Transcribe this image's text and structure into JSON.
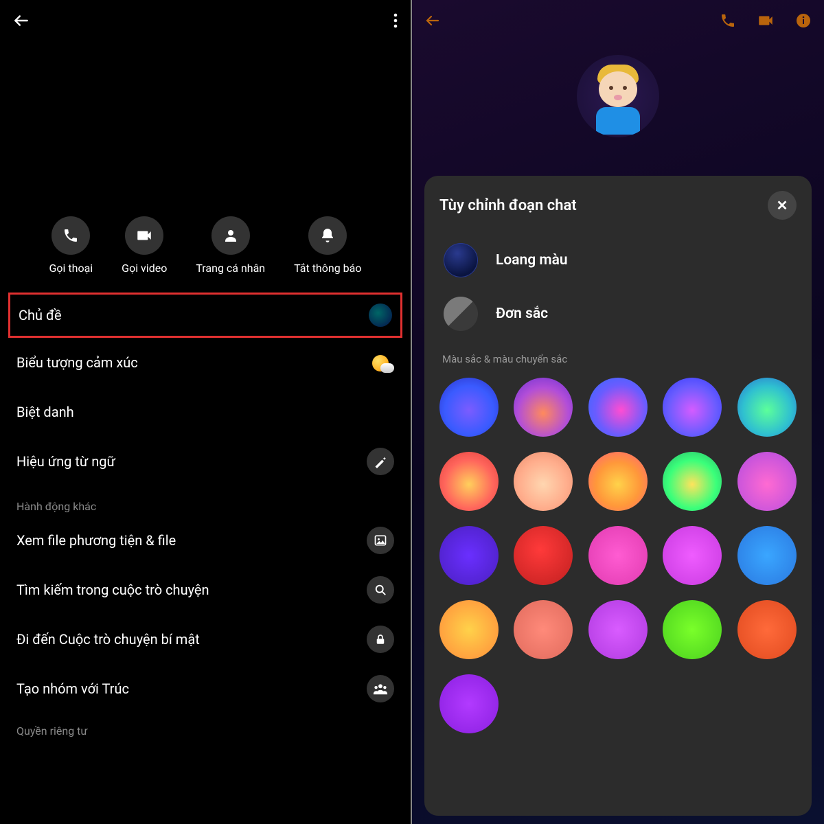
{
  "left": {
    "actions": {
      "call": "Gọi thoại",
      "video": "Gọi video",
      "profile": "Trang cá nhân",
      "mute": "Tắt thông báo"
    },
    "menu": {
      "theme": "Chủ đề",
      "emoji": "Biểu tượng cảm xúc",
      "nickname": "Biệt danh",
      "word_effects": "Hiệu ứng từ ngữ"
    },
    "sections": {
      "other": "Hành động khác",
      "privacy": "Quyền riêng tư"
    },
    "other": {
      "media": "Xem file phương tiện & file",
      "search": "Tìm kiếm trong cuộc trò chuyện",
      "secret": "Đi đến Cuộc trò chuyện bí mật",
      "group": "Tạo nhóm với Trúc"
    }
  },
  "right": {
    "sheet_title": "Tùy chỉnh đoạn chat",
    "option_gradient": "Loang màu",
    "option_solid": "Đơn sắc",
    "grid_label": "Màu sắc & màu chuyển sắc",
    "colors": [
      "radial-gradient(circle at 50% 55%, #7b5cff, #3a5bff 55%, #2a2fbf)",
      "radial-gradient(circle at 50% 60%, #ff8a5c, #b24ed8 55%, #6a2fd0)",
      "radial-gradient(circle at 55% 55%, #ff4dd2, #6a5cff 55%, #2f6aff)",
      "radial-gradient(circle at 50% 55%, #d45cff, #6a5cff 55%, #2f3aff)",
      "radial-gradient(circle at 50% 55%, #5cff9a, #2fc0d0 55%, #2a6ad0)",
      "radial-gradient(circle at 50% 55%, #ffcf5c, #ff665c 55%, #e03a3a)",
      "radial-gradient(circle at 50% 55%, #ffd6b0, #ffad8c 55%, #e88a6a)",
      "radial-gradient(circle at 50% 55%, #ffd24a, #ff983a 50%, #ff5c7a)",
      "radial-gradient(circle at 50% 55%, #ffe35c, #3aff7a 55%, #2ab06a)",
      "radial-gradient(circle at 50% 55%, #ff6ad2, #b04ae0)",
      "radial-gradient(circle at 50% 50%, #6a2fff, #4a1fc0)",
      "radial-gradient(circle at 45% 40%, #ff3a3a, #c01f1f)",
      "radial-gradient(circle at 50% 50%, #ff5cd2, #e03ab0)",
      "radial-gradient(circle at 50% 50%, #ef5cff, #c83ae0)",
      "radial-gradient(circle at 50% 50%, #3aa6ff, #2a78e0)",
      "radial-gradient(circle at 50% 50%, #ffd24a, #ff8c3a)",
      "radial-gradient(circle at 50% 50%, #ff8a7a, #e06a5c)",
      "radial-gradient(circle at 50% 50%, #d95cff, #b03ae0)",
      "radial-gradient(circle at 50% 50%, #7aff2a, #4ad01f)",
      "radial-gradient(circle at 50% 50%, #ff6a3a, #e04a1f)",
      "radial-gradient(circle at 50% 50%, #b23aff, #8a1fe0)"
    ]
  }
}
